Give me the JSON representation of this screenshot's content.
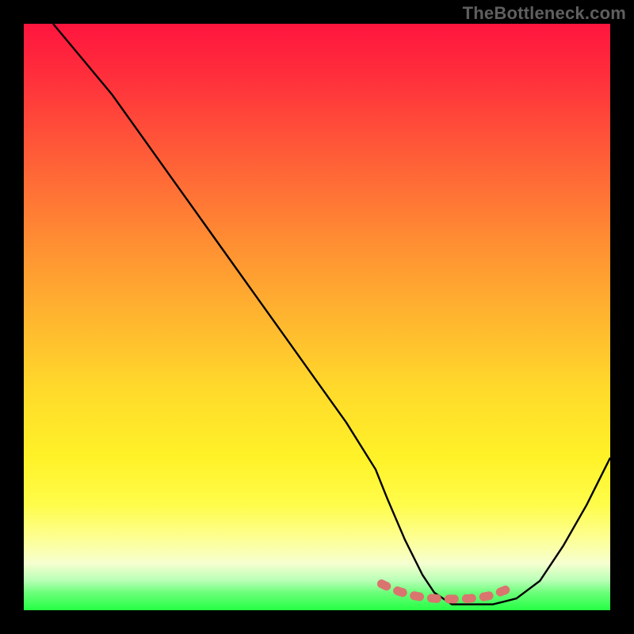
{
  "watermark": "TheBottleneck.com",
  "chart_data": {
    "type": "line",
    "title": "",
    "xlabel": "",
    "ylabel": "",
    "xlim": [
      0,
      100
    ],
    "ylim": [
      0,
      100
    ],
    "series": [
      {
        "name": "bottleneck-curve",
        "x": [
          5,
          10,
          15,
          20,
          25,
          30,
          35,
          40,
          45,
          50,
          55,
          60,
          62,
          65,
          68,
          70,
          73,
          76,
          80,
          84,
          88,
          92,
          96,
          100
        ],
        "y": [
          100,
          94,
          88,
          81,
          74,
          67,
          60,
          53,
          46,
          39,
          32,
          24,
          19,
          12,
          6,
          3,
          1,
          1,
          1,
          2,
          5,
          11,
          18,
          26
        ]
      },
      {
        "name": "highlight-band",
        "x": [
          61,
          62.5,
          64,
          66,
          68,
          70,
          72,
          74,
          76,
          78,
          80,
          81.5,
          83
        ],
        "y": [
          4.5,
          3.8,
          3.2,
          2.6,
          2.2,
          2.0,
          1.9,
          1.9,
          2.0,
          2.2,
          2.6,
          3.2,
          3.8
        ]
      }
    ],
    "colors": {
      "curve": "#000000",
      "highlight": "#d9756e",
      "gradient_top": "#ff153e",
      "gradient_bottom": "#24ff44",
      "frame": "#000000"
    }
  }
}
